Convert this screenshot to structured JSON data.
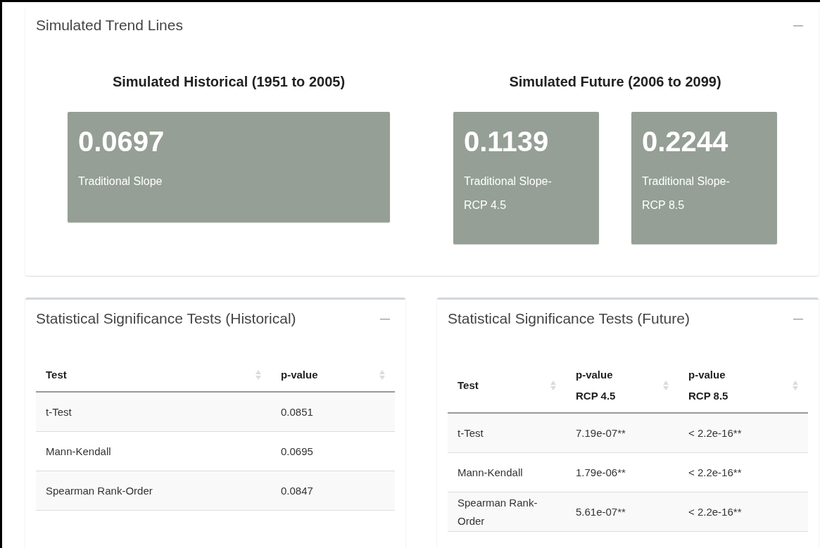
{
  "trend_panel": {
    "title": "Simulated Trend Lines",
    "groups": [
      {
        "title": "Simulated Historical (1951 to 2005)",
        "boxes": [
          {
            "value": "0.0697",
            "label": "Traditional Slope"
          }
        ]
      },
      {
        "title": "Simulated Future (2006 to 2099)",
        "boxes": [
          {
            "value": "0.1139",
            "label": "Traditional Slope-RCP 4.5"
          },
          {
            "value": "0.2244",
            "label": "Traditional Slope-RCP 8.5"
          }
        ]
      }
    ]
  },
  "test_panels": [
    {
      "title": "Statistical Significance Tests (Historical)",
      "columns": [
        "Test",
        "p-value"
      ],
      "rows": [
        [
          "t-Test",
          "0.0851"
        ],
        [
          "Mann-Kendall",
          "0.0695"
        ],
        [
          "Spearman Rank-Order",
          "0.0847"
        ]
      ]
    },
    {
      "title": "Statistical Significance Tests (Future)",
      "columns": [
        "Test",
        "p-value RCP 4.5",
        "p-value RCP 8.5"
      ],
      "rows": [
        [
          "t-Test",
          "7.19e-07**",
          "< 2.2e-16**"
        ],
        [
          "Mann-Kendall",
          "1.79e-06**",
          "< 2.2e-16**"
        ],
        [
          "Spearman Rank-Order",
          "5.61e-07**",
          "< 2.2e-16**"
        ]
      ]
    }
  ]
}
